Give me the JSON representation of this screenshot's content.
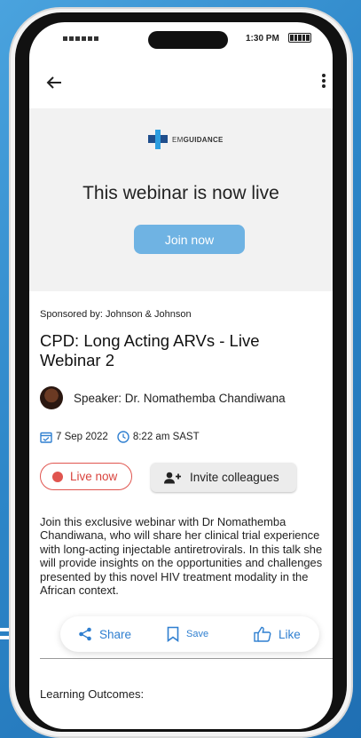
{
  "status_bar": {
    "time": "1:30 PM"
  },
  "brand": {
    "prefix": "EM",
    "name": "GUIDANCE"
  },
  "hero": {
    "title": "This webinar is now live",
    "join_label": "Join now"
  },
  "event": {
    "sponsor": "Sponsored by: Johnson & Johnson",
    "title": "CPD: Long Acting ARVs - Live Webinar 2",
    "speaker": "Speaker: Dr. Nomathemba Chandiwana",
    "date": "7 Sep 2022",
    "time": "8:22 am SAST",
    "live_label": "Live now",
    "invite_label": "Invite colleagues",
    "description": "Join this exclusive webinar with Dr Nomathemba Chandiwana, who will share her clinical trial experience with long-acting injectable antiretrovirals. In this talk she will provide insights on the opportunities and challenges presented by this novel HIV treatment modality in the African context."
  },
  "actions": {
    "share": "Share",
    "save": "Save",
    "like": "Like"
  },
  "section": {
    "learning_outcomes": "Learning Outcomes:"
  },
  "colors": {
    "accent": "#2f7fd0",
    "live": "#e0554f",
    "join_button": "#6fb3e3",
    "background": "#2d86c8"
  },
  "icons": [
    "back-arrow-icon",
    "more-vertical-icon",
    "calendar-icon",
    "clock-icon",
    "add-person-icon",
    "share-icon",
    "bookmark-icon",
    "thumbs-up-icon"
  ]
}
